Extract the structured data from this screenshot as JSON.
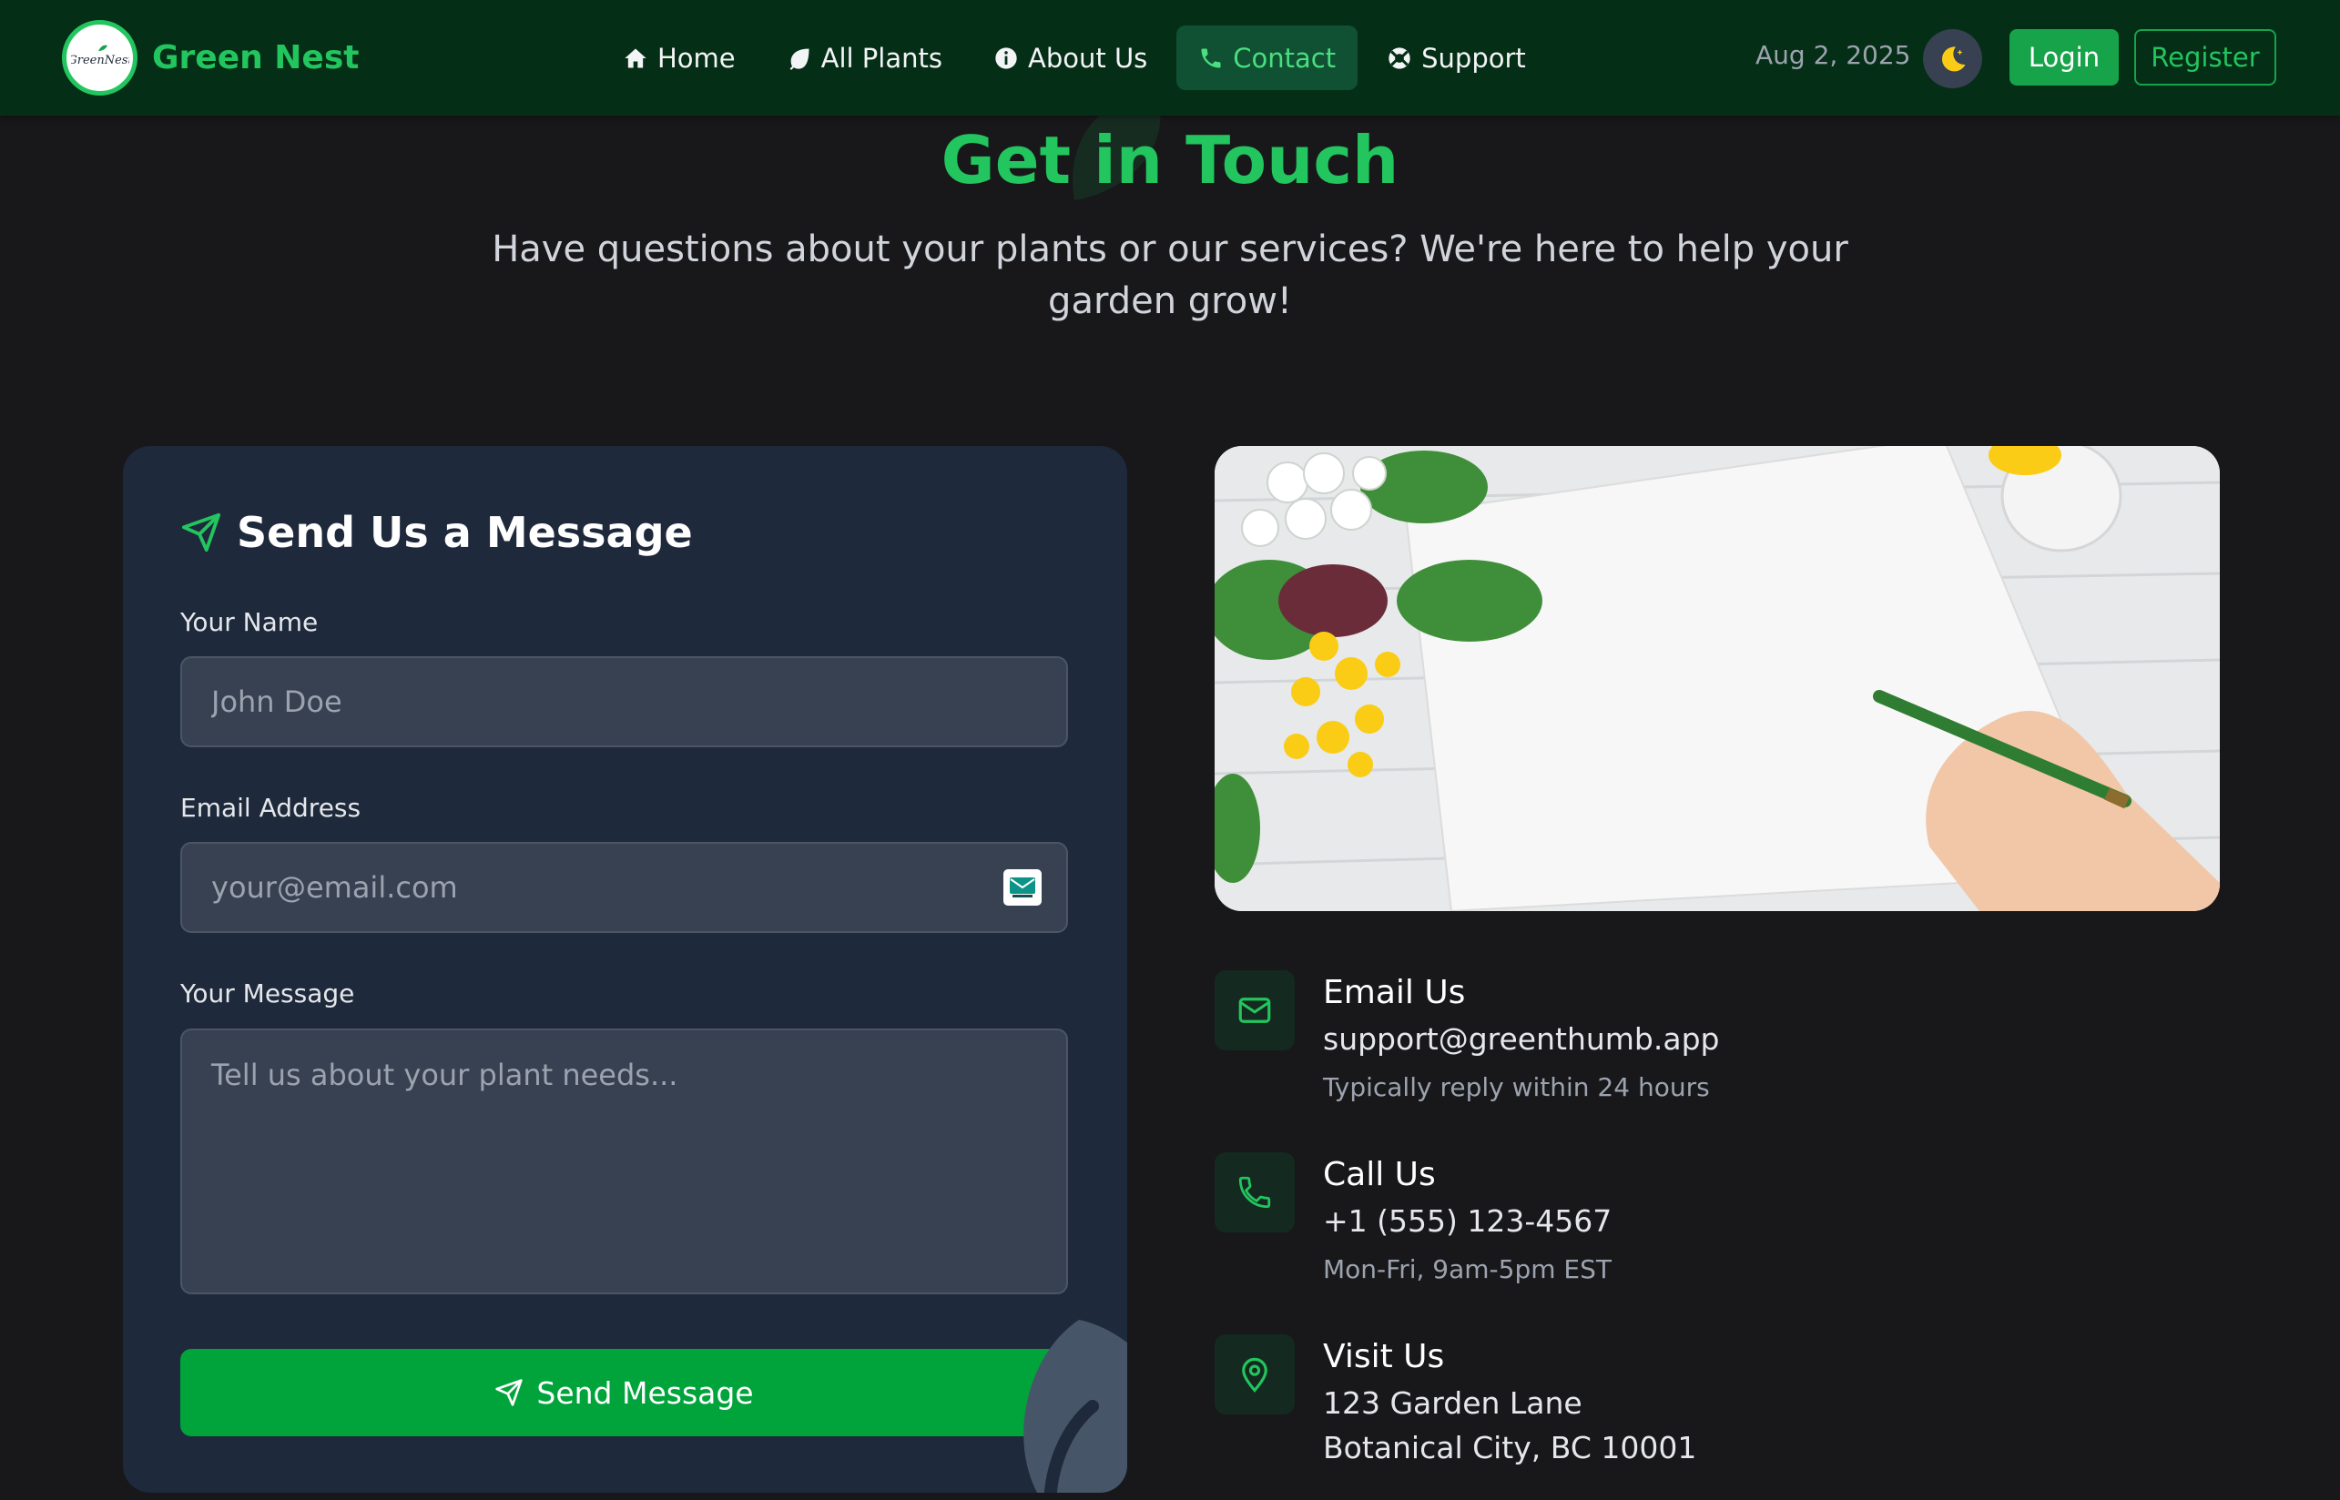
{
  "nav": {
    "brand": "Green Nest",
    "logo_text": "GreenNest",
    "links": [
      "Home",
      "All Plants",
      "About Us",
      "Contact",
      "Support"
    ],
    "active": "Contact",
    "date": "Aug 2, 2025",
    "login": "Login",
    "register": "Register"
  },
  "hero": {
    "title": "Get in Touch",
    "subtitle": "Have questions about your plants or our services? We're here to help your garden grow!"
  },
  "form": {
    "title": "Send Us a Message",
    "name_label": "Your Name",
    "name_placeholder": "John Doe",
    "email_label": "Email Address",
    "email_placeholder": "your@email.com",
    "message_label": "Your Message",
    "message_placeholder": "Tell us about your plant needs...",
    "submit": "Send Message"
  },
  "contact": [
    {
      "title": "Email Us",
      "lines": [
        "support@greenthumb.app"
      ],
      "note": "Typically reply within 24 hours",
      "icon": "mail-icon"
    },
    {
      "title": "Call Us",
      "lines": [
        "+1 (555) 123-4567"
      ],
      "note": "Mon-Fri, 9am-5pm EST",
      "icon": "phone-icon"
    },
    {
      "title": "Visit Us",
      "lines": [
        "123 Garden Lane",
        "Botanical City, BC 10001"
      ],
      "icon": "map-pin-icon"
    }
  ],
  "colors": {
    "accent": "#22c55e",
    "button": "#00a43b",
    "navbar_bg": "#052e16",
    "page_bg": "#18181b",
    "card_bg": "#1e293b",
    "input_bg": "#374151"
  }
}
